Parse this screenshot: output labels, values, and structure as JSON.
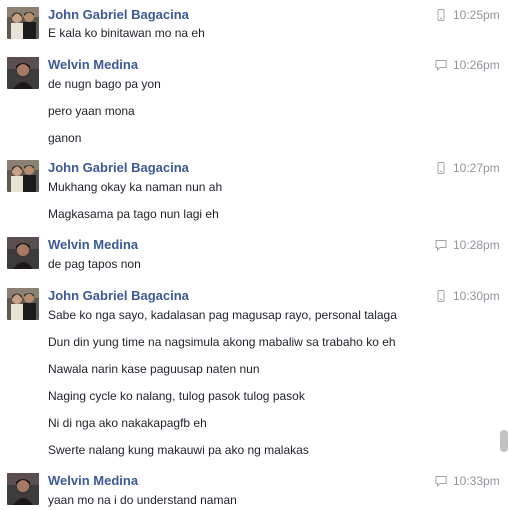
{
  "conversation": {
    "groups": [
      {
        "sender": "John Gabriel Bagacina",
        "avatar": "john-avatar",
        "source_icon": "mobile-phone-icon",
        "time": "10:25pm",
        "messages": [
          "E kala ko binitawan mo na eh"
        ]
      },
      {
        "sender": "Welvin Medina",
        "avatar": "welvin-avatar",
        "source_icon": "chat-bubble-icon",
        "time": "10:26pm",
        "messages": [
          "de nugn bago pa yon",
          "pero yaan mona",
          "ganon"
        ]
      },
      {
        "sender": "John Gabriel Bagacina",
        "avatar": "john-avatar",
        "source_icon": "mobile-phone-icon",
        "time": "10:27pm",
        "messages": [
          "Mukhang okay ka naman nun ah",
          "Magkasama pa tago nun lagi eh"
        ]
      },
      {
        "sender": "Welvin Medina",
        "avatar": "welvin-avatar",
        "source_icon": "chat-bubble-icon",
        "time": "10:28pm",
        "messages": [
          "de pag tapos non"
        ]
      },
      {
        "sender": "John Gabriel Bagacina",
        "avatar": "john-avatar",
        "source_icon": "mobile-phone-icon",
        "time": "10:30pm",
        "messages": [
          "Sabe ko nga sayo, kadalasan pag magusap rayo, personal talaga",
          "Dun din yung time na nagsimula akong mabaliw sa trabaho ko eh",
          "Nawala narin kase paguusap naten nun",
          "Naging cycle ko nalang, tulog pasok tulog pasok",
          "Ni di nga ako nakakapagfb eh",
          "Swerte nalang kung makauwi pa ako ng malakas"
        ]
      },
      {
        "sender": "Welvin Medina",
        "avatar": "welvin-avatar",
        "source_icon": "chat-bubble-icon",
        "time": "10:33pm",
        "messages": [
          "yaan mo na i do understand naman"
        ]
      }
    ]
  },
  "colors": {
    "sender_name": "#3b5998",
    "message_text": "#1d2129",
    "timestamp": "#90949c",
    "scrollbar": "#c2c2c2"
  }
}
